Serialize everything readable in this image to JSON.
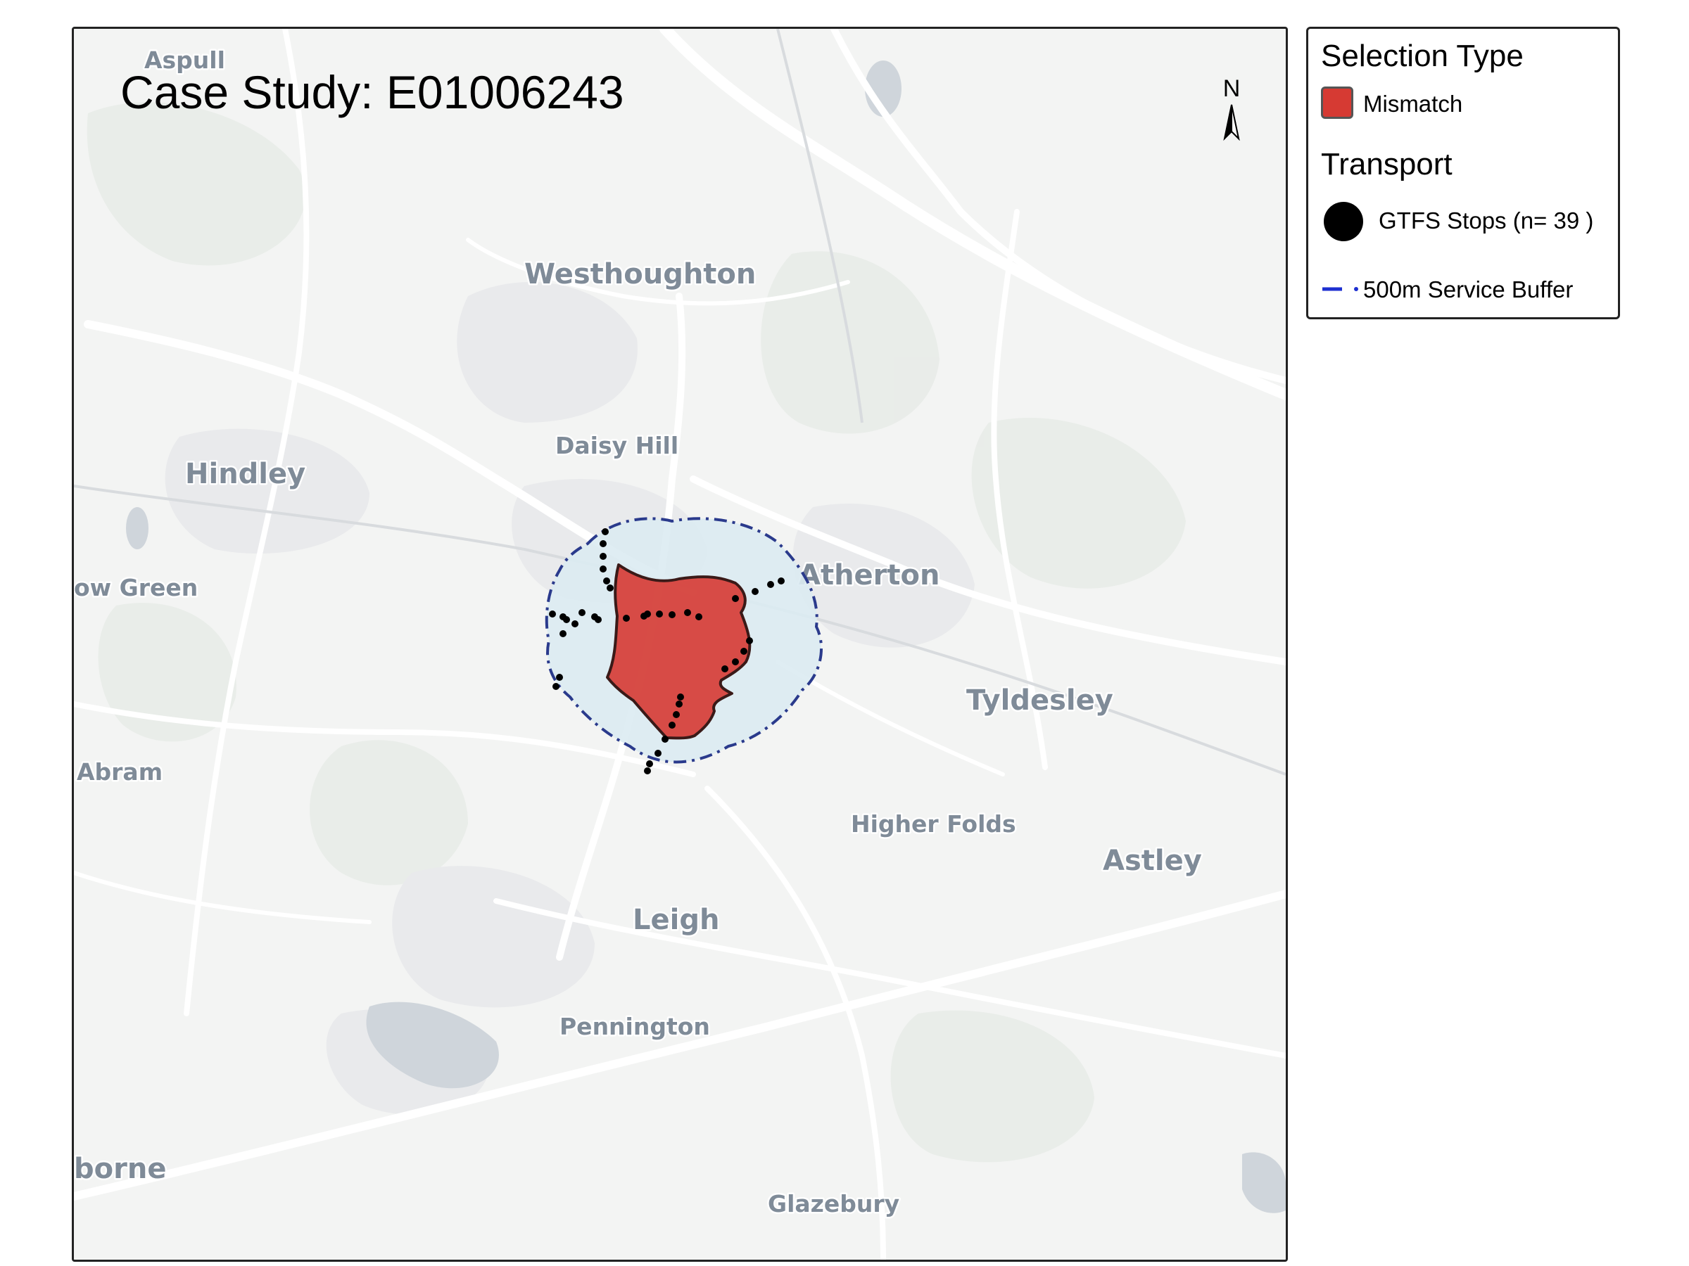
{
  "map": {
    "title": "Case Study: E01006243",
    "north_label": "N",
    "places": [
      {
        "id": "aspull",
        "name": "Aspull"
      },
      {
        "id": "westhoughton",
        "name": "Westhoughton"
      },
      {
        "id": "daisy-hill",
        "name": "Daisy Hill"
      },
      {
        "id": "hindley",
        "name": "Hindley"
      },
      {
        "id": "bow-green",
        "name": "ow Green"
      },
      {
        "id": "atherton",
        "name": "Atherton"
      },
      {
        "id": "tyldesley",
        "name": "Tyldesley"
      },
      {
        "id": "abram",
        "name": "Abram"
      },
      {
        "id": "higher-folds",
        "name": "Higher Folds"
      },
      {
        "id": "astley",
        "name": "Astley"
      },
      {
        "id": "leigh",
        "name": "Leigh"
      },
      {
        "id": "pennington",
        "name": "Pennington"
      },
      {
        "id": "golborne",
        "name": "borne"
      },
      {
        "id": "glazebury",
        "name": "Glazebury"
      }
    ],
    "colors": {
      "mismatch_fill": "#d63a33",
      "buffer_fill": "#dcebf2",
      "buffer_stroke": "#2a3a8c",
      "stop": "#000000",
      "basemap": "#f3f4f3"
    },
    "stop_count": 39
  },
  "legend": {
    "selection_title": "Selection Type",
    "mismatch_label": "Mismatch",
    "transport_title": "Transport",
    "stops_label": "GTFS Stops (n= 39 )",
    "buffer_label": "500m Service Buffer"
  }
}
